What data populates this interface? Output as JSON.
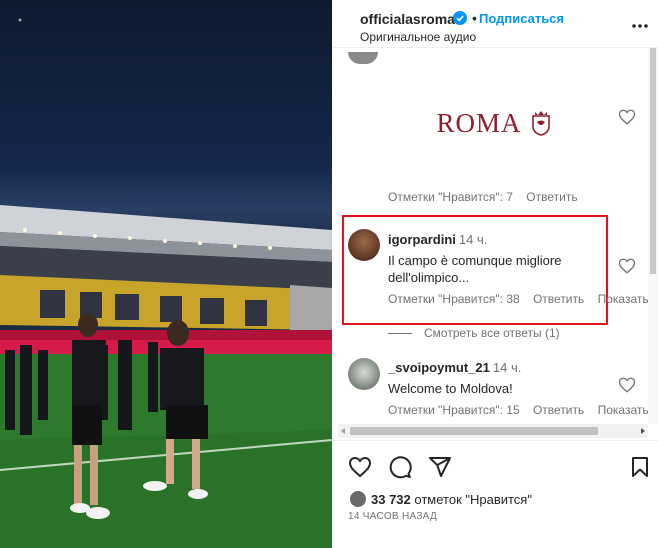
{
  "header": {
    "username": "officialasroma",
    "follow_label": "Подписаться",
    "audio_label": "Оригинальное аудио"
  },
  "image_comment": {
    "brand_word": "ROMA",
    "meta": {
      "likes": "Отметки \"Нравится\": 7",
      "reply": "Ответить"
    }
  },
  "comments": [
    {
      "username": "igorpardini",
      "time": "14 ч.",
      "text_line1": "Il campo è comunque migliore",
      "text_line2": "dell'olimpico...",
      "likes": "Отметки \"Нравится\": 38",
      "reply": "Ответить",
      "show": "Показать"
    },
    {
      "username": "_svoipoymut_21",
      "time": "14 ч.",
      "text": "Welcome to Moldova!",
      "likes": "Отметки \"Нравится\": 15",
      "reply": "Ответить",
      "show": "Показать"
    }
  ],
  "see_replies": "Смотреть все ответы (1)",
  "footer": {
    "likes_count": "33 732",
    "likes_suffix": "отметок \"Нравится\"",
    "posted_ago": "14 ЧАСОВ НАЗАД"
  },
  "colors": {
    "accent": "#0095f6",
    "roma_red": "#8e1f2f",
    "highlight_red": "#e0141e"
  }
}
